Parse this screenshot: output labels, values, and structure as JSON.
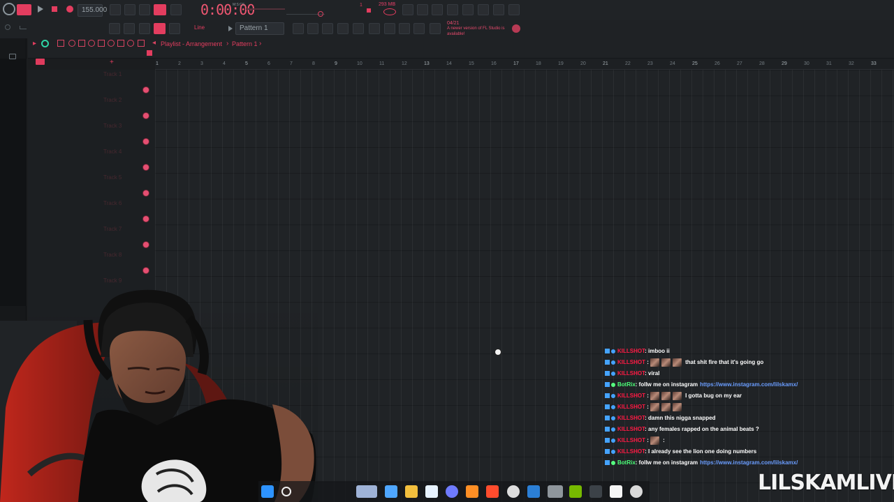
{
  "app": {
    "brand_color": "#e33d5f",
    "title": "Playlist - Arrangement",
    "pattern_breadcrumb": "Pattern 1"
  },
  "transport": {
    "tempo": "155.000",
    "time": "0:00:00",
    "time_unit": "M:S:CS",
    "memory": "293 MB",
    "cpu_label": "1",
    "cpu_value": "0",
    "update_date": "04/21",
    "update_text": "A newer version of FL Studio is available!"
  },
  "toolbar": {
    "line_mode": "Line",
    "pattern_selector": "Pattern 1"
  },
  "ruler": {
    "bars": [
      "1",
      "2",
      "3",
      "4",
      "5",
      "6",
      "7",
      "8",
      "9",
      "10",
      "11",
      "12",
      "13",
      "14",
      "15",
      "16",
      "17",
      "18",
      "19",
      "20",
      "21",
      "22",
      "23",
      "24",
      "25",
      "26",
      "27",
      "28",
      "29",
      "30",
      "31",
      "32",
      "33"
    ]
  },
  "tracks": [
    {
      "name": "Track 1"
    },
    {
      "name": "Track 2"
    },
    {
      "name": "Track 3"
    },
    {
      "name": "Track 4"
    },
    {
      "name": "Track 5"
    },
    {
      "name": "Track 6"
    },
    {
      "name": "Track 7"
    },
    {
      "name": "Track 8"
    },
    {
      "name": "Track 9"
    }
  ],
  "chat": {
    "messages": [
      {
        "user": "KILLSHOT",
        "text": ": imboo ii",
        "emotes": 0,
        "link": ""
      },
      {
        "user": "KILLSHOT",
        "text": "that shit fire that it's going go",
        "emotes": 3,
        "link": ""
      },
      {
        "user": "KILLSHOT",
        "text": ": viral",
        "emotes": 0,
        "link": ""
      },
      {
        "user": "BotRix",
        "text": ": follw me on instagram",
        "emotes": 0,
        "link": "https://www.instagram.com/lilskamx/"
      },
      {
        "user": "KILLSHOT",
        "text": "I gotta bug on my ear",
        "emotes": 3,
        "link": ""
      },
      {
        "user": "KILLSHOT",
        "text": "",
        "emotes": 3,
        "link": ""
      },
      {
        "user": "KILLSHOT",
        "text": ": damn this nigga snapped",
        "emotes": 0,
        "link": ""
      },
      {
        "user": "KILLSHOT",
        "text": ": any females rapped on the animal beats ?",
        "emotes": 0,
        "link": ""
      },
      {
        "user": "KILLSHOT",
        "text": ":",
        "emotes": 1,
        "link": ""
      },
      {
        "user": "KILLSHOT",
        "text": ": I already see the lion one doing numbers",
        "emotes": 0,
        "link": ""
      },
      {
        "user": "BotRix",
        "text": ": follw me on instagram",
        "emotes": 0,
        "link": "https://www.instagram.com/lilskamx/"
      }
    ]
  },
  "stream": {
    "watermark": "LILSKAMLIVE"
  },
  "taskbar": {
    "icons": [
      "windows-icon",
      "search-icon",
      "widget-icon",
      "copilot-icon",
      "folder-icon",
      "store-icon",
      "discord-icon",
      "fl-studio-icon",
      "brave-icon",
      "chrome-icon",
      "steam-icon",
      "obs-icon",
      "nvidia-icon",
      "display-icon",
      "capcut-icon",
      "media-player-icon"
    ]
  }
}
